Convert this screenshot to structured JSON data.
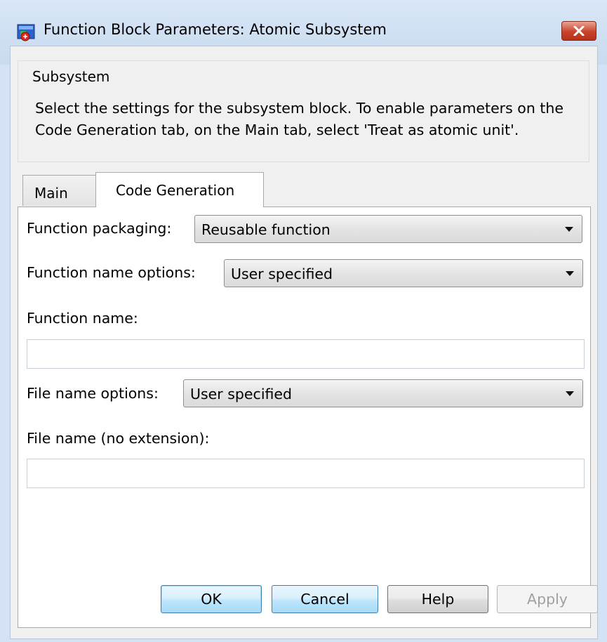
{
  "window": {
    "title": "Function Block Parameters: Atomic Subsystem"
  },
  "subsystem": {
    "legend": "Subsystem",
    "description": "Select the settings for the subsystem block. To enable parameters on the Code Generation tab, on the Main tab, select 'Treat as atomic unit'."
  },
  "tabs": {
    "main": "Main",
    "code_generation": "Code Generation",
    "active": "Code Generation"
  },
  "code_generation": {
    "function_packaging": {
      "label": "Function packaging:",
      "value": "Reusable function"
    },
    "function_name_options": {
      "label": "Function name options:",
      "value": "User specified"
    },
    "function_name": {
      "label": "Function name:",
      "value": ""
    },
    "file_name_options": {
      "label": "File name options:",
      "value": "User specified"
    },
    "file_name": {
      "label": "File name (no extension):",
      "value": ""
    }
  },
  "buttons": {
    "ok": "OK",
    "cancel": "Cancel",
    "help": "Help",
    "apply": "Apply"
  },
  "colors": {
    "close_button": "#c8432a",
    "default_button_border": "#3c7fb1"
  },
  "icons": {
    "app": "simulink-block-icon",
    "close": "close-icon",
    "dropdown": "chevron-down-icon"
  }
}
